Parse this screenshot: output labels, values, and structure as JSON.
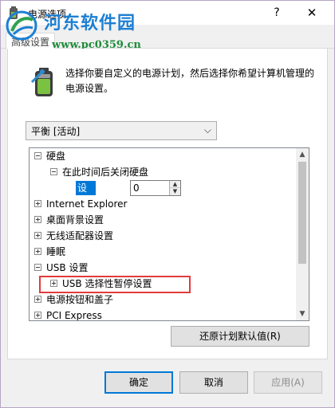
{
  "window": {
    "title": "电源选项",
    "help_label": "?",
    "close_label": "✕"
  },
  "watermark": {
    "title": "河东软件园",
    "url": "www.pc0359.cn"
  },
  "tab": {
    "label": "高级设置"
  },
  "description": "选择你要自定义的电源计划，然后选择你希望计算机管理的电源设置。",
  "plan_select": {
    "value": "平衡 [活动]",
    "chevron": "⌵"
  },
  "tree": {
    "items": [
      {
        "label": "硬盘",
        "state": "collapse",
        "level": 0
      },
      {
        "label": "在此时间后关闭硬盘",
        "state": "collapse",
        "level": 1
      },
      {
        "label": "Internet Explorer",
        "state": "expand",
        "level": 0
      },
      {
        "label": "桌面背景设置",
        "state": "expand",
        "level": 0
      },
      {
        "label": "无线适配器设置",
        "state": "expand",
        "level": 0
      },
      {
        "label": "睡眠",
        "state": "expand",
        "level": 0
      },
      {
        "label": "USB 设置",
        "state": "collapse",
        "level": 0
      },
      {
        "label": "USB 选择性暂停设置",
        "state": "expand",
        "level": 1
      },
      {
        "label": "电源按钮和盖子",
        "state": "expand",
        "level": 0
      },
      {
        "label": "PCI Express",
        "state": "expand",
        "level": 0
      }
    ],
    "setting": {
      "label": "设置(分钟):",
      "value": "0"
    }
  },
  "restore_button": "还原计划默认值(R)",
  "buttons": {
    "ok": "确定",
    "cancel": "取消",
    "apply": "应用(A)"
  },
  "colors": {
    "selection": "#0078d7",
    "highlight_box": "#e23b3b",
    "watermark_title": "#1c7fd3",
    "watermark_url": "#1e8c3a"
  }
}
